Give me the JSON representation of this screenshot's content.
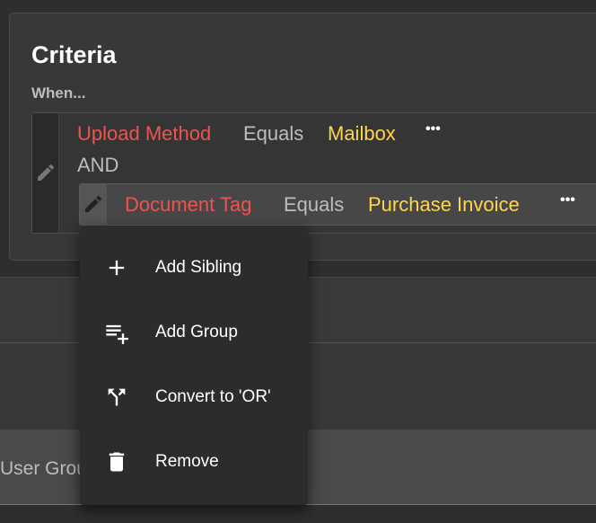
{
  "criteria": {
    "title": "Criteria",
    "when_label": "When...",
    "condition1": {
      "field": "Upload Method",
      "operator": "Equals",
      "value": "Mailbox"
    },
    "conjunction": "AND",
    "condition2": {
      "field": "Document Tag",
      "operator": "Equals",
      "value": "Purchase Invoice"
    },
    "more_label": "•••"
  },
  "background_field": "User Group",
  "menu": {
    "items": [
      {
        "label": "Add Sibling",
        "icon": "plus-icon"
      },
      {
        "label": "Add Group",
        "icon": "playlist-add-icon"
      },
      {
        "label": "Convert to 'OR'",
        "icon": "call-split-icon"
      },
      {
        "label": "Remove",
        "icon": "trash-icon"
      }
    ]
  },
  "colors": {
    "field": "#ef5350",
    "operator": "#bdbdbd",
    "value": "#ffd54f"
  }
}
